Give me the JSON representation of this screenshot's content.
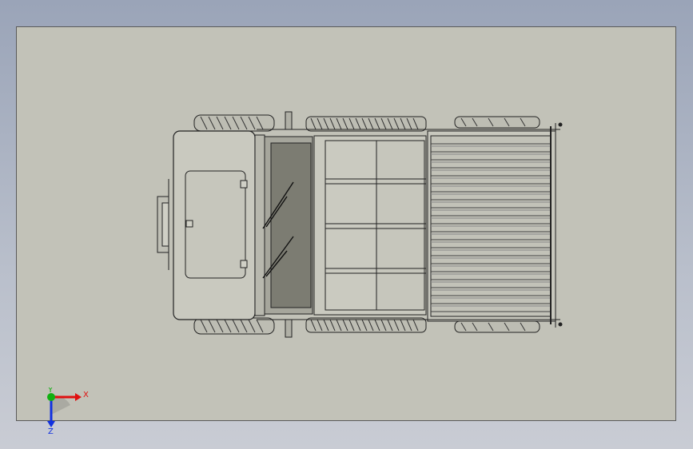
{
  "viewport": {
    "background": "#c2c2b8",
    "model": "vehicle-top-view"
  },
  "triad": {
    "x_label": "X",
    "y_label": "Y",
    "z_label": "Z",
    "x_color": "#e01010",
    "y_color": "#10b010",
    "z_color": "#1030e0"
  }
}
